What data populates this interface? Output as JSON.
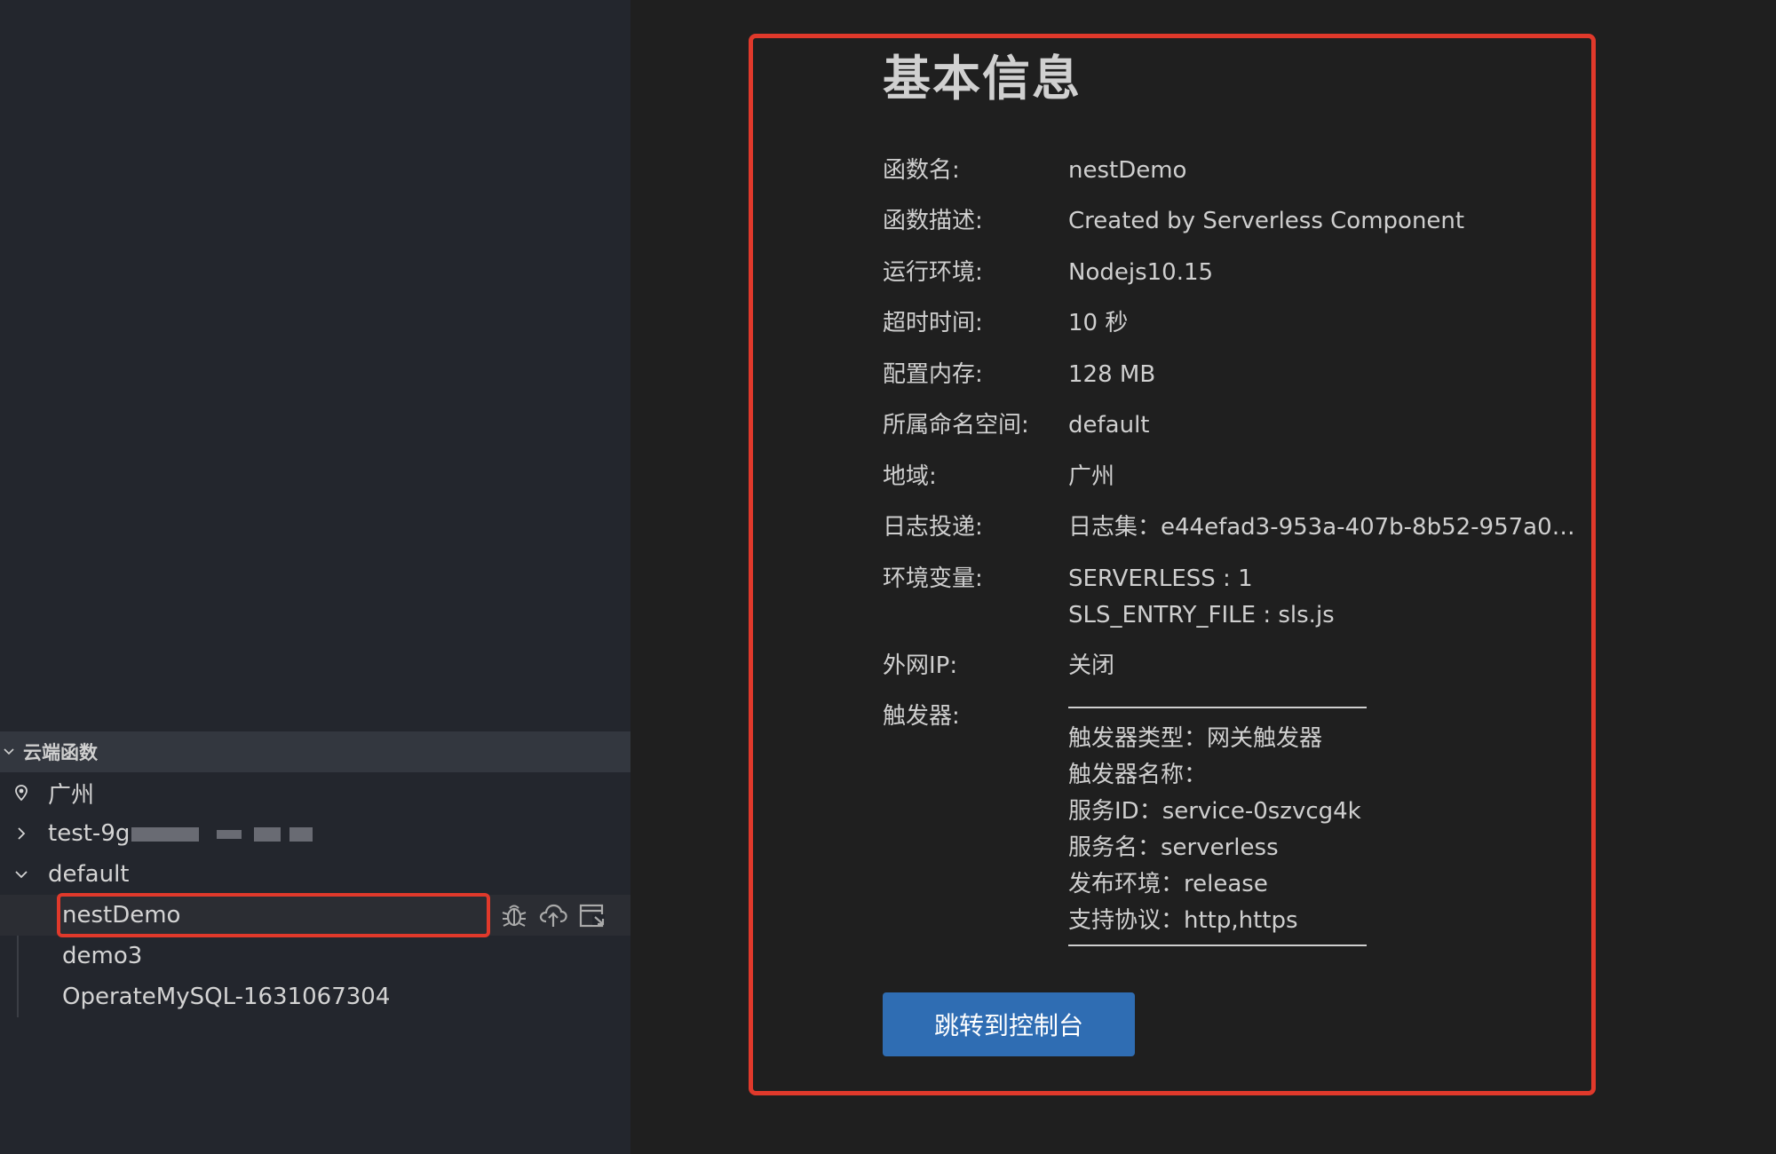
{
  "sidebar": {
    "section_title": "云端函数",
    "region": "广州",
    "namespaces": [
      {
        "label": "test-9g",
        "expanded": false,
        "blurred": true
      },
      {
        "label": "default",
        "expanded": true
      }
    ],
    "functions": [
      {
        "label": "nestDemo",
        "selected": true
      },
      {
        "label": "demo3"
      },
      {
        "label": "OperateMySQL-1631067304"
      }
    ],
    "row_actions": [
      "debug-icon",
      "cloud-upload-icon",
      "open-panel-icon"
    ]
  },
  "detail": {
    "title": "基本信息",
    "fields": [
      {
        "key": "函数名:",
        "value": "nestDemo"
      },
      {
        "key": "函数描述:",
        "value": "Created by Serverless Component"
      },
      {
        "key": "运行环境:",
        "value": "Nodejs10.15"
      },
      {
        "key": "超时时间:",
        "value": "10 秒"
      },
      {
        "key": "配置内存:",
        "value": "128 MB"
      },
      {
        "key": "所属命名空间:",
        "value": "default"
      },
      {
        "key": "地域:",
        "value": "广州"
      },
      {
        "key": "日志投递:",
        "value": "日志集：e44efad3-953a-407b-8b52-957a01..."
      }
    ],
    "env": {
      "key": "环境变量:",
      "values": [
        "SERVERLESS : 1",
        "SLS_ENTRY_FILE : sls.js"
      ]
    },
    "public_ip": {
      "key": "外网IP:",
      "value": "关闭"
    },
    "trigger": {
      "key": "触发器:",
      "lines": [
        "触发器类型：网关触发器",
        "触发器名称：",
        "服务ID：service-0szvcg4k",
        "服务名：serverless",
        "发布环境：release",
        "支持协议：http,https"
      ]
    },
    "console_button": "跳转到控制台"
  },
  "colors": {
    "highlight": "#e0392b",
    "button": "#2f6db3",
    "sidebar_bg": "#23262d",
    "section_header_bg": "#33373f",
    "editor_bg": "#1f1f1f"
  }
}
